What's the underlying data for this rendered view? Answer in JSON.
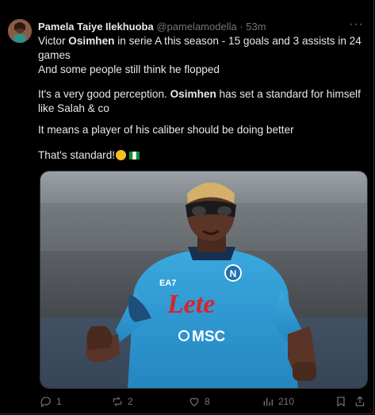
{
  "tweet": {
    "author_name": "Pamela Taiye Ilekhuoba",
    "author_handle": "@pamelamodella",
    "separator": "·",
    "time": "53m",
    "more_icon": "more-icon",
    "line1": {
      "pre": "Victor ",
      "bold": "Osimhen",
      "post": "  in serie A this season - 15 goals and 3 assists in 24 games"
    },
    "line2": "And some people still think he flopped",
    "line3": {
      "pre": "It's a very good perception. ",
      "bold": "Osimhen",
      "post": " has set a standard for himself like Salah & co"
    },
    "line4": "It means a player of his caliber should be doing better",
    "line5": "That's standard!",
    "line5_emoji": "smiling-face-icon",
    "line5_flag": "nigeria-flag-icon"
  },
  "media": {
    "jersey_sponsor": "Lete",
    "jersey_sponsor2": "MSC",
    "jersey_brand": "EA7"
  },
  "actions": {
    "replies": "1",
    "reposts": "2",
    "likes": "8",
    "views": "210"
  },
  "colors": {
    "background": "#000000",
    "text": "#e7e9ea",
    "muted": "#71767b",
    "jersey": "#2d9fd8"
  }
}
